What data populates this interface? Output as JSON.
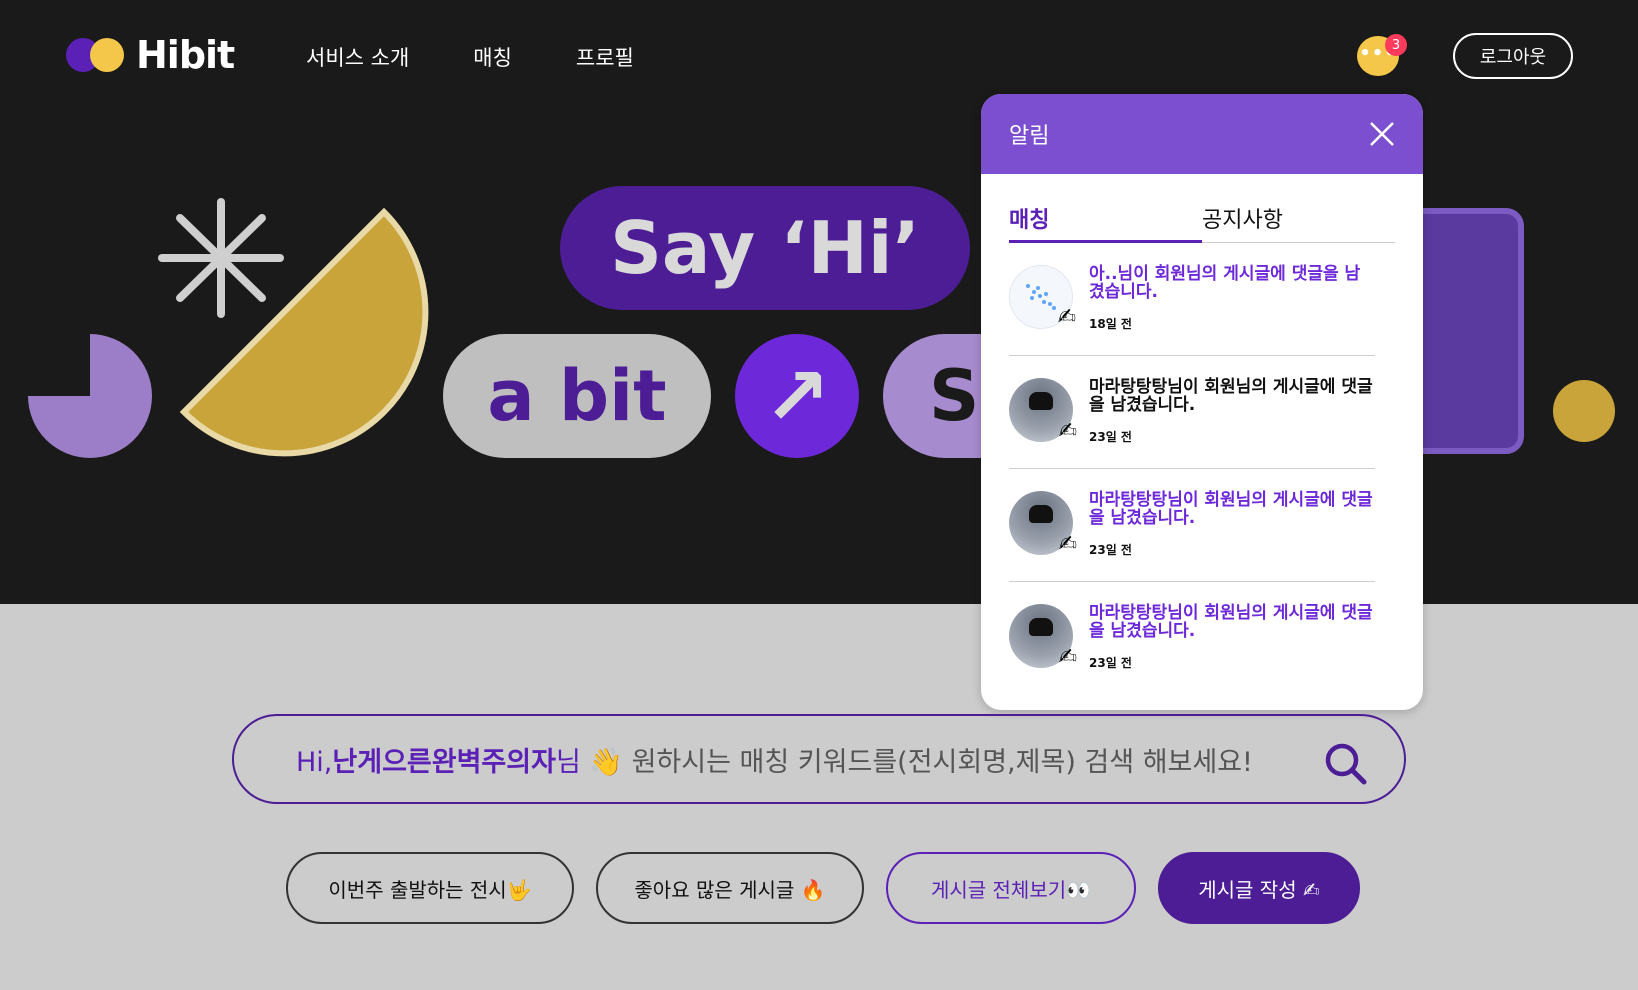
{
  "header": {
    "logo_text": "Hibit",
    "nav": [
      "서비스 소개",
      "매칭",
      "프로필"
    ],
    "chat_badge": "3",
    "logout_label": "로그아웃"
  },
  "hero": {
    "say_text": "Say ‘Hi’",
    "abit_text": "a bit",
    "arrow_glyph": "↗",
    "sh_text": "Sh"
  },
  "notifications": {
    "title": "알림",
    "tabs": [
      "매칭",
      "공지사항"
    ],
    "active_tab": "매칭",
    "items": [
      {
        "message": "아..님이 회원님의 게시글에 댓글을 남겼습니다.",
        "time": "18일 전",
        "unread": true,
        "thumb": "chart-thumbnail"
      },
      {
        "message": "마라탕탕탕님이 회원님의 게시글에 댓글을 남겼습니다.",
        "time": "23일 전",
        "unread": false,
        "thumb": "cat-avatar"
      },
      {
        "message": "마라탕탕탕님이 회원님의 게시글에 댓글을 남겼습니다.",
        "time": "23일 전",
        "unread": true,
        "thumb": "cat-avatar"
      },
      {
        "message": "마라탕탕탕님이 회원님의 게시글에 댓글을 남겼습니다.",
        "time": "23일 전",
        "unread": true,
        "thumb": "cat-avatar"
      }
    ]
  },
  "search": {
    "greeting": "Hi,",
    "nickname": "난게으른완벽주의자",
    "suffix": "님 👋",
    "prompt": "원하시는 매칭 키워드를(전시회명,제목) 검색 해보세요!"
  },
  "buttons": [
    {
      "label": "이번주 출발하는 전시🤟"
    },
    {
      "label": "좋아요 많은 게시글 🔥"
    },
    {
      "label": "게시글 전체보기👀"
    },
    {
      "label": "게시글 작성 ✍"
    }
  ],
  "colors": {
    "accent": "#5b21b6",
    "panel_header": "#7b4fd0",
    "yellow": "#f4c64a",
    "dark_bg": "#1a1a1a"
  }
}
